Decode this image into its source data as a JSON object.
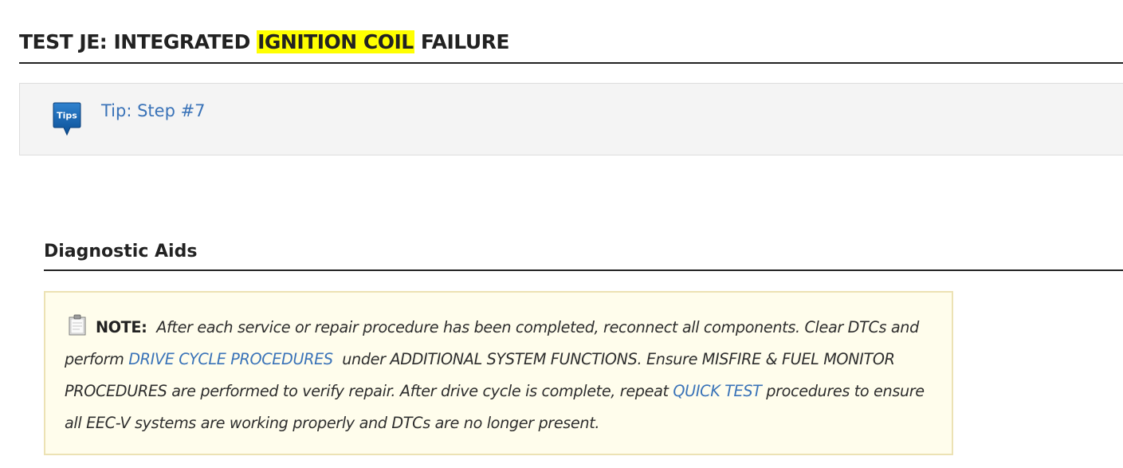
{
  "title": {
    "prefix": "TEST JE: INTEGRATED ",
    "highlight": "IGNITION COIL",
    "suffix": " FAILURE",
    "highlight_color": "#ffff00"
  },
  "tip": {
    "icon": "tips-icon",
    "icon_label": "Tips",
    "link_text": "Tip: Step #7"
  },
  "diagnostic_aids": {
    "heading": "Diagnostic Aids",
    "note": {
      "icon": "note-icon",
      "label": "NOTE:",
      "text_1": " After each service or repair procedure has been completed, reconnect all components. Clear DTCs and perform ",
      "link_1": "DRIVE CYCLE PROCEDURES",
      "text_2": "  under ADDITIONAL SYSTEM FUNCTIONS. Ensure MISFIRE & FUEL MONITOR PROCEDURES are performed to verify repair. After drive cycle is complete, repeat ",
      "link_2": "QUICK TEST",
      "text_3": " procedures to ensure all EEC-V systems are working properly and DTCs are no longer present."
    }
  },
  "colors": {
    "link": "#3a73b8",
    "note_background": "#fffdec",
    "note_border": "#ece2b4",
    "tip_background": "#f4f4f4"
  }
}
